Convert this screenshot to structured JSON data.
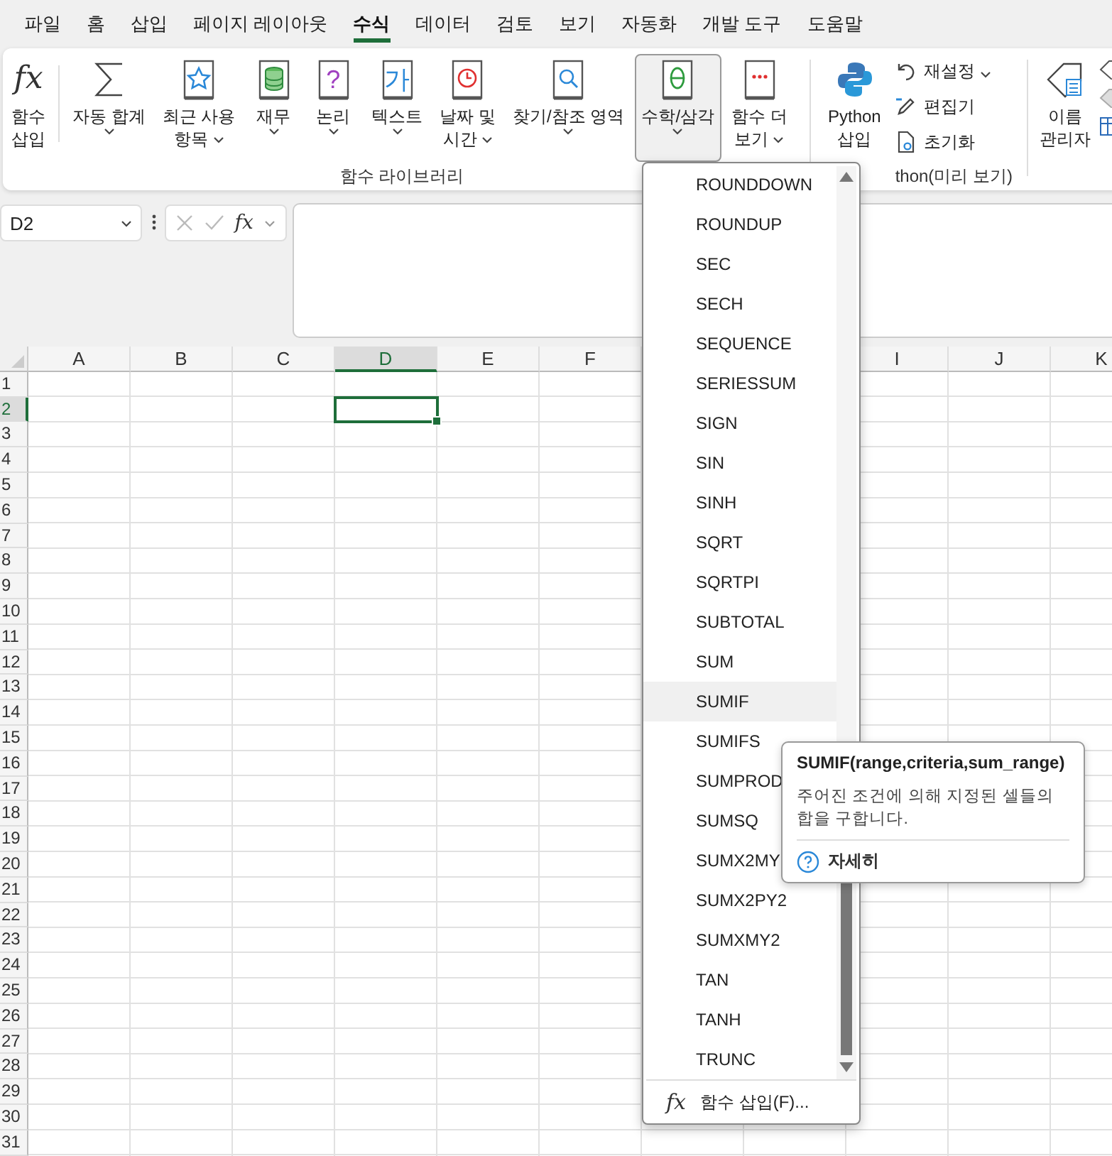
{
  "menu_tabs": [
    {
      "label": "파일",
      "selected": false
    },
    {
      "label": "홈",
      "selected": false
    },
    {
      "label": "삽입",
      "selected": false
    },
    {
      "label": "페이지 레이아웃",
      "selected": false
    },
    {
      "label": "수식",
      "selected": true
    },
    {
      "label": "데이터",
      "selected": false
    },
    {
      "label": "검토",
      "selected": false
    },
    {
      "label": "보기",
      "selected": false
    },
    {
      "label": "자동화",
      "selected": false
    },
    {
      "label": "개발 도구",
      "selected": false
    },
    {
      "label": "도움말",
      "selected": false
    }
  ],
  "ribbon": {
    "function_library": {
      "label": "함수 라이브러리",
      "buttons": [
        {
          "kind": "fx",
          "glyph": "fx",
          "lines": [
            "함수",
            "삽입"
          ],
          "dropdown": false,
          "pressed": false
        },
        {
          "kind": "sum",
          "lines": [
            "자동 합계"
          ],
          "dropdown": true,
          "pressed": false
        },
        {
          "kind": "star",
          "lines": [
            "최근 사용",
            "항목"
          ],
          "dropdown": true,
          "pressed": false
        },
        {
          "kind": "database",
          "lines": [
            "재무"
          ],
          "dropdown": true,
          "pressed": false
        },
        {
          "kind": "glyph",
          "glyph": "?",
          "color": "#a040c0",
          "lines": [
            "논리"
          ],
          "dropdown": true,
          "pressed": false
        },
        {
          "kind": "glyph",
          "glyph": "가",
          "color": "#2a88d8",
          "lines": [
            "텍스트"
          ],
          "dropdown": true,
          "pressed": false
        },
        {
          "kind": "clock",
          "lines": [
            "날짜 및",
            "시간"
          ],
          "dropdown": true,
          "pressed": false
        },
        {
          "kind": "magnifier",
          "lines": [
            "찾기/참조 영역"
          ],
          "dropdown": true,
          "pressed": false
        },
        {
          "kind": "theta",
          "lines": [
            "수학/삼각"
          ],
          "dropdown": true,
          "pressed": true
        },
        {
          "kind": "dots",
          "lines": [
            "함수 더",
            "보기"
          ],
          "dropdown": true,
          "pressed": false
        }
      ]
    },
    "python": {
      "label": "thon(미리 보기)",
      "insert_lines": [
        "Python",
        "삽입"
      ],
      "small_buttons": [
        {
          "kind": "undo",
          "label": "재설정"
        },
        {
          "kind": "pencil",
          "label": "편집기"
        },
        {
          "kind": "doc",
          "label": "초기화"
        }
      ]
    },
    "names": {
      "lines": [
        "이름",
        "관리자"
      ]
    }
  },
  "formula_bar": {
    "name_box": {
      "value": "D2"
    },
    "fx": "fx"
  },
  "grid": {
    "columns": [
      {
        "label": "A",
        "selected": false
      },
      {
        "label": "B",
        "selected": false
      },
      {
        "label": "C",
        "selected": false
      },
      {
        "label": "D",
        "selected": true
      },
      {
        "label": "E",
        "selected": false
      },
      {
        "label": "F",
        "selected": false
      },
      {},
      {},
      {
        "label": "I",
        "selected": false
      },
      {
        "label": "J",
        "selected": false
      },
      {
        "label": "K",
        "selected": false
      }
    ],
    "rows": [
      {
        "label": "1",
        "selected": false
      },
      {
        "label": "2",
        "selected": true
      },
      {
        "label": "3",
        "selected": false
      },
      {
        "label": "4",
        "selected": false
      },
      {
        "label": "5",
        "selected": false
      },
      {
        "label": "6",
        "selected": false
      },
      {
        "label": "7",
        "selected": false
      },
      {
        "label": "8",
        "selected": false
      },
      {
        "label": "9",
        "selected": false
      },
      {
        "label": "10",
        "selected": false
      },
      {
        "label": "11",
        "selected": false
      },
      {
        "label": "12",
        "selected": false
      },
      {
        "label": "13",
        "selected": false
      },
      {
        "label": "14",
        "selected": false
      },
      {
        "label": "15",
        "selected": false
      },
      {
        "label": "16",
        "selected": false
      },
      {
        "label": "17",
        "selected": false
      },
      {
        "label": "18",
        "selected": false
      },
      {
        "label": "19",
        "selected": false
      },
      {
        "label": "20",
        "selected": false
      },
      {
        "label": "21",
        "selected": false
      },
      {
        "label": "22",
        "selected": false
      },
      {
        "label": "23",
        "selected": false
      },
      {
        "label": "24",
        "selected": false
      },
      {
        "label": "25",
        "selected": false
      },
      {
        "label": "26",
        "selected": false
      },
      {
        "label": "27",
        "selected": false
      },
      {
        "label": "28",
        "selected": false
      },
      {
        "label": "29",
        "selected": false
      },
      {
        "label": "30",
        "selected": false
      },
      {
        "label": "31",
        "selected": false
      }
    ]
  },
  "dropdown": {
    "items": [
      {
        "label": "ROUNDDOWN",
        "selected": false
      },
      {
        "label": "ROUNDUP",
        "selected": false
      },
      {
        "label": "SEC",
        "selected": false
      },
      {
        "label": "SECH",
        "selected": false
      },
      {
        "label": "SEQUENCE",
        "selected": false
      },
      {
        "label": "SERIESSUM",
        "selected": false
      },
      {
        "label": "SIGN",
        "selected": false
      },
      {
        "label": "SIN",
        "selected": false
      },
      {
        "label": "SINH",
        "selected": false
      },
      {
        "label": "SQRT",
        "selected": false
      },
      {
        "label": "SQRTPI",
        "selected": false
      },
      {
        "label": "SUBTOTAL",
        "selected": false
      },
      {
        "label": "SUM",
        "selected": false
      },
      {
        "label": "SUMIF",
        "selected": true
      },
      {
        "label": "SUMIFS",
        "selected": false
      },
      {
        "label": "SUMPROD",
        "selected": false
      },
      {
        "label": "SUMSQ",
        "selected": false
      },
      {
        "label": "SUMX2MY",
        "selected": false
      },
      {
        "label": "SUMX2PY2",
        "selected": false
      },
      {
        "label": "SUMXMY2",
        "selected": false
      },
      {
        "label": "TAN",
        "selected": false
      },
      {
        "label": "TANH",
        "selected": false
      },
      {
        "label": "TRUNC",
        "selected": false
      }
    ],
    "footer": {
      "glyph": "fx",
      "label": "함수 삽입(F)..."
    }
  },
  "tooltip": {
    "title": "SUMIF(range,criteria,sum_range)",
    "description": "주어진 조건에 의해 지정된 셀들의 합을 구합니다.",
    "link": "자세히"
  }
}
